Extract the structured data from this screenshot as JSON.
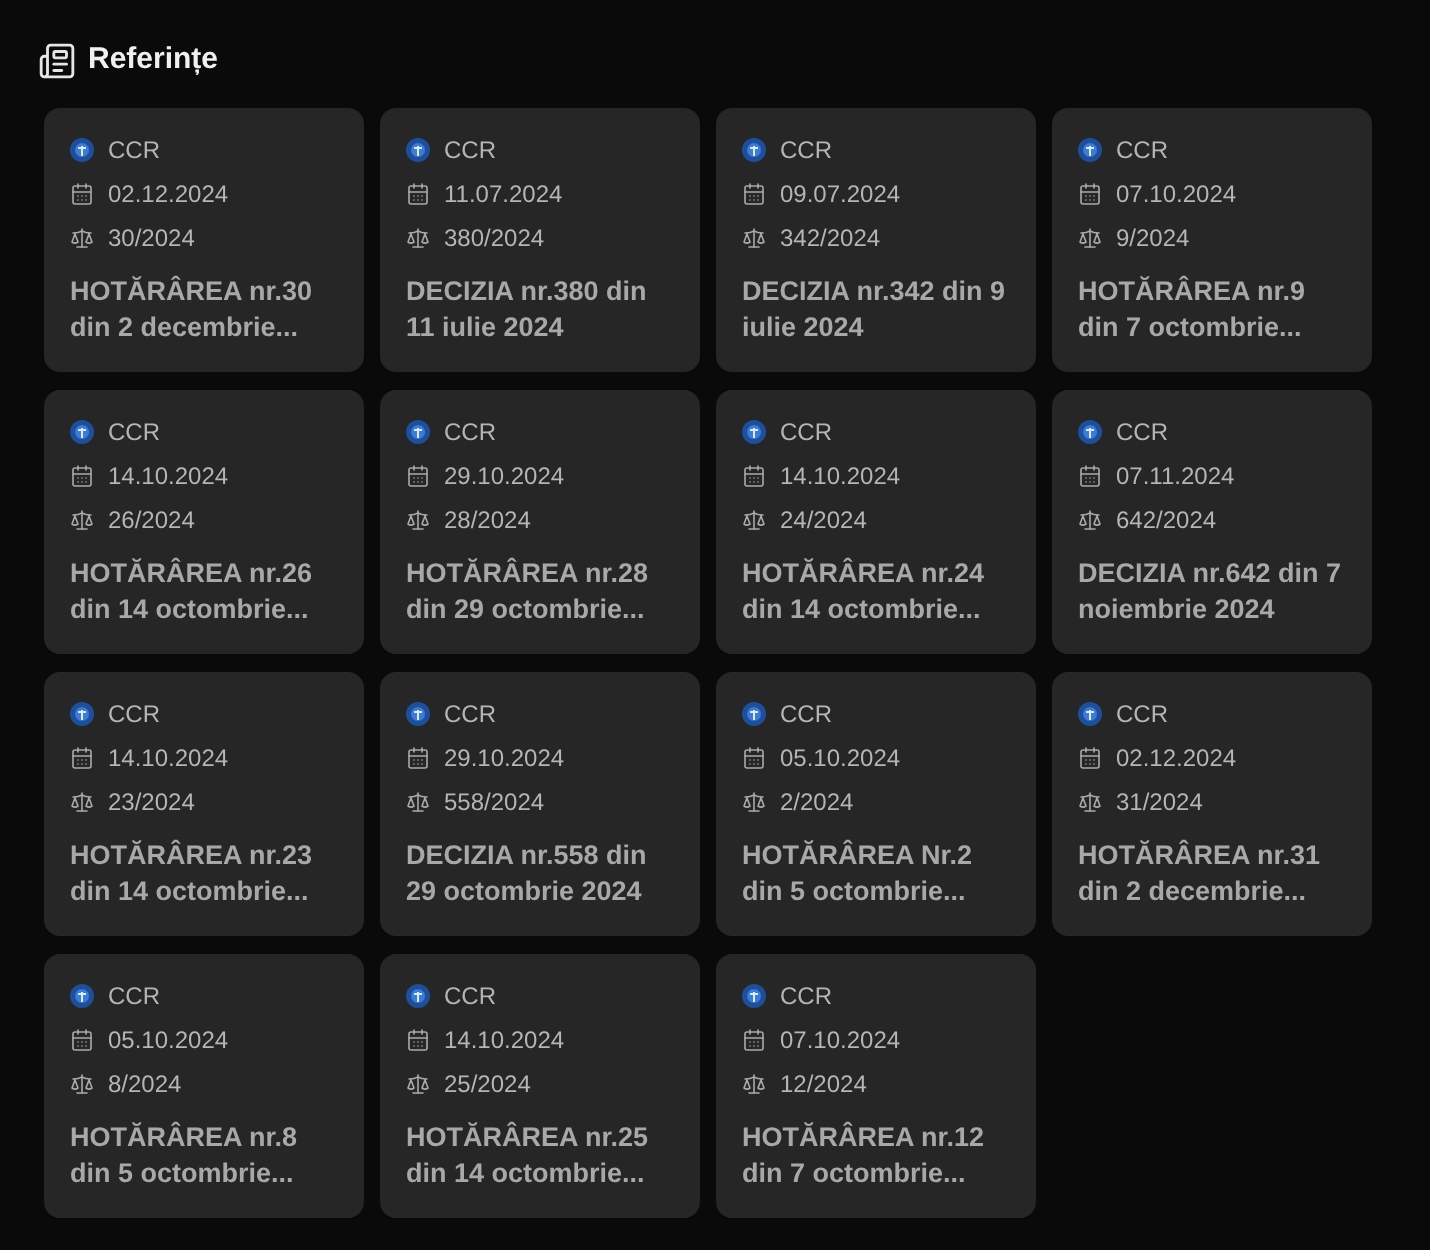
{
  "title": "Referințe",
  "cards": [
    {
      "source": "CCR",
      "date": "02.12.2024",
      "number": "30/2024",
      "heading": "HOTĂRÂREA nr.30 din 2 decembrie..."
    },
    {
      "source": "CCR",
      "date": "11.07.2024",
      "number": "380/2024",
      "heading": "DECIZIA nr.380 din 11 iulie 2024"
    },
    {
      "source": "CCR",
      "date": "09.07.2024",
      "number": "342/2024",
      "heading": "DECIZIA nr.342 din 9 iulie 2024"
    },
    {
      "source": "CCR",
      "date": "07.10.2024",
      "number": "9/2024",
      "heading": "HOTĂRÂREA nr.9 din 7 octombrie..."
    },
    {
      "source": "CCR",
      "date": "14.10.2024",
      "number": "26/2024",
      "heading": "HOTĂRÂREA nr.26 din 14 octombrie..."
    },
    {
      "source": "CCR",
      "date": "29.10.2024",
      "number": "28/2024",
      "heading": "HOTĂRÂREA nr.28 din 29 octombrie..."
    },
    {
      "source": "CCR",
      "date": "14.10.2024",
      "number": "24/2024",
      "heading": "HOTĂRÂREA nr.24 din 14 octombrie..."
    },
    {
      "source": "CCR",
      "date": "07.11.2024",
      "number": "642/2024",
      "heading": "DECIZIA nr.642 din 7 noiembrie 2024"
    },
    {
      "source": "CCR",
      "date": "14.10.2024",
      "number": "23/2024",
      "heading": "HOTĂRÂREA nr.23 din 14 octombrie..."
    },
    {
      "source": "CCR",
      "date": "29.10.2024",
      "number": "558/2024",
      "heading": "DECIZIA nr.558 din 29 octombrie 2024"
    },
    {
      "source": "CCR",
      "date": "05.10.2024",
      "number": "2/2024",
      "heading": "HOTĂRÂREA Nr.2 din 5 octombrie..."
    },
    {
      "source": "CCR",
      "date": "02.12.2024",
      "number": "31/2024",
      "heading": "HOTĂRÂREA nr.31 din 2 decembrie..."
    },
    {
      "source": "CCR",
      "date": "05.10.2024",
      "number": "8/2024",
      "heading": "HOTĂRÂREA nr.8 din 5 octombrie..."
    },
    {
      "source": "CCR",
      "date": "14.10.2024",
      "number": "25/2024",
      "heading": "HOTĂRÂREA nr.25 din 14 octombrie..."
    },
    {
      "source": "CCR",
      "date": "07.10.2024",
      "number": "12/2024",
      "heading": "HOTĂRÂREA nr.12 din 7 octombrie..."
    }
  ]
}
